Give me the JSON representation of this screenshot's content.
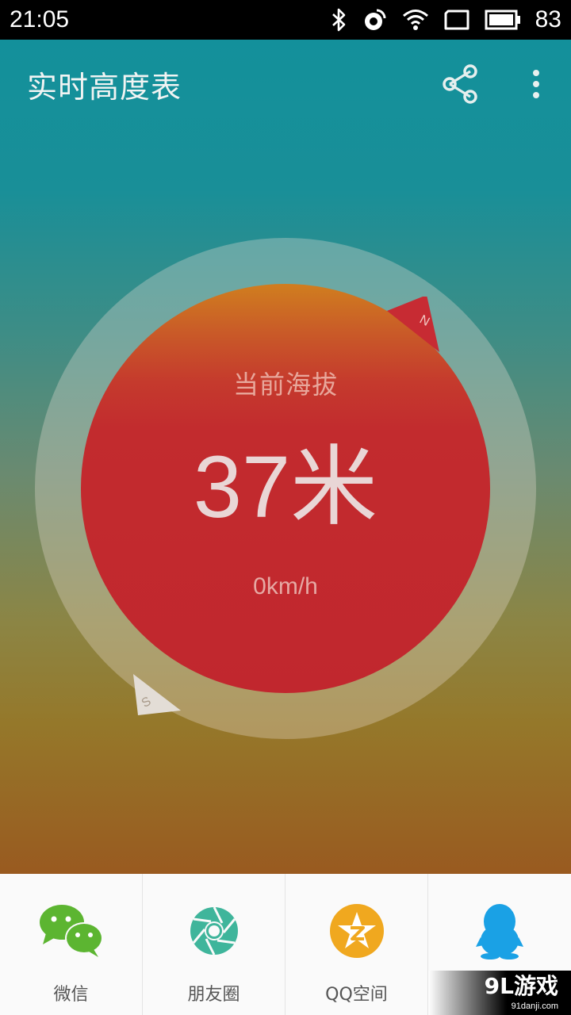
{
  "status_bar": {
    "time": "21:05",
    "battery": "83",
    "icons": [
      "bluetooth-icon",
      "location-icon",
      "wifi-icon",
      "tablet-icon",
      "battery-icon"
    ]
  },
  "toolbar": {
    "title": "实时高度表",
    "share_icon": "share-icon",
    "more_icon": "more-vert-icon"
  },
  "altimeter": {
    "label": "当前海拔",
    "value": "37米",
    "speed": "0km/h",
    "compass_north": "N",
    "compass_south": "S"
  },
  "share_bar": {
    "items": [
      {
        "label": "微信",
        "icon": "wechat-icon"
      },
      {
        "label": "朋友圈",
        "icon": "moments-icon"
      },
      {
        "label": "QQ空间",
        "icon": "qzone-icon"
      },
      {
        "label": "",
        "icon": "qq-icon"
      }
    ]
  },
  "watermark": {
    "logo": "9L游戏",
    "url": "91danji.com"
  },
  "colors": {
    "status_bar": "#000000",
    "gradient_top": "#13909b",
    "gradient_bottom": "#995a20",
    "disc": "#c1272e",
    "wechat_green": "#5cb531",
    "moments_teal": "#3fb59b",
    "qzone_orange": "#f0a81f",
    "qq_blue": "#1aa1e5"
  }
}
